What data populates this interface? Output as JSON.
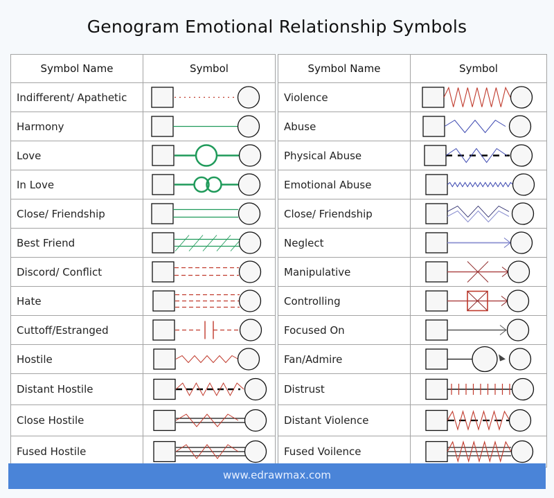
{
  "title": "Genogram Emotional Relationship Symbols",
  "headers": {
    "name": "Symbol Name",
    "symbol": "Symbol"
  },
  "colors": {
    "green": "#1f9a5a",
    "red": "#c0392b",
    "blue": "#3a46b0",
    "black": "#111111",
    "footer": "#4a84d8"
  },
  "left": [
    {
      "name": "Indifferent/ Apathetic",
      "symbol": "indifferent"
    },
    {
      "name": "Harmony",
      "symbol": "harmony"
    },
    {
      "name": "Love",
      "symbol": "love"
    },
    {
      "name": "In Love",
      "symbol": "in-love"
    },
    {
      "name": "Close/ Friendship",
      "symbol": "close-friendship-green"
    },
    {
      "name": "Best Friend",
      "symbol": "best-friend"
    },
    {
      "name": "Discord/ Conflict",
      "symbol": "discord"
    },
    {
      "name": "Hate",
      "symbol": "hate"
    },
    {
      "name": "Cuttoff/Estranged",
      "symbol": "cutoff"
    },
    {
      "name": "Hostile",
      "symbol": "hostile"
    },
    {
      "name": "Distant Hostile",
      "symbol": "distant-hostile"
    },
    {
      "name": "Close Hostile",
      "symbol": "close-hostile"
    },
    {
      "name": "Fused Hostile",
      "symbol": "fused-hostile"
    }
  ],
  "right": [
    {
      "name": "Violence",
      "symbol": "violence"
    },
    {
      "name": "Abuse",
      "symbol": "abuse"
    },
    {
      "name": "Physical Abuse",
      "symbol": "physical-abuse"
    },
    {
      "name": "Emotional Abuse",
      "symbol": "emotional-abuse"
    },
    {
      "name": "Close/ Friendship",
      "symbol": "close-friendship-blue"
    },
    {
      "name": "Neglect",
      "symbol": "neglect"
    },
    {
      "name": "Manipulative",
      "symbol": "manipulative"
    },
    {
      "name": "Controlling",
      "symbol": "controlling"
    },
    {
      "name": "Focused On",
      "symbol": "focused-on"
    },
    {
      "name": "Fan/Admire",
      "symbol": "fan-admire"
    },
    {
      "name": "Distrust",
      "symbol": "distrust"
    },
    {
      "name": "Distant Violence",
      "symbol": "distant-violence"
    },
    {
      "name": "Fused Voilence",
      "symbol": "fused-violence"
    }
  ],
  "footer": "www.edrawmax.com"
}
